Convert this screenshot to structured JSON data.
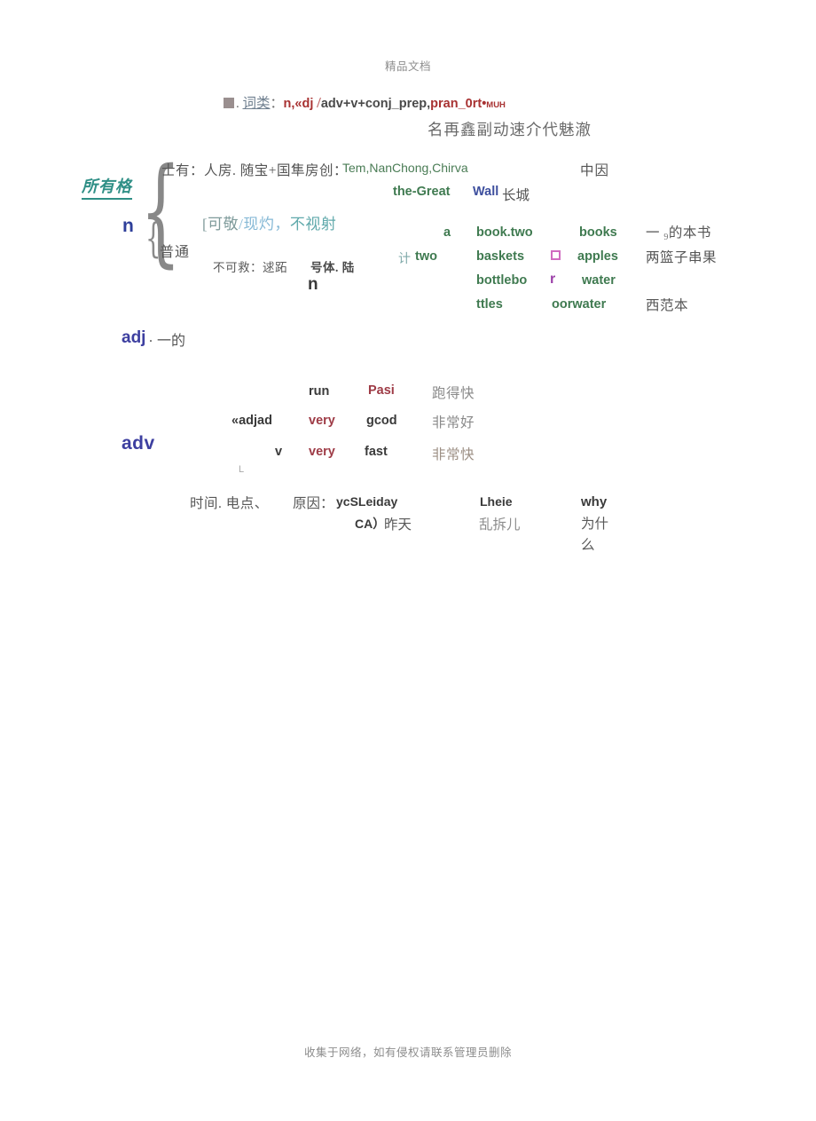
{
  "document": {
    "watermark_top": "精品文档",
    "watermark_bottom": "收集于网络，如有侵权请联系管理员删除"
  },
  "header": {
    "bullet_icon": "filled-square-bullet",
    "label_cn": "词类",
    "colon": "：",
    "pos_red": "n,«dj",
    "slash": "/",
    "pos_dark": "adv+v+conj_prep,",
    "pos_red2": "pran_0rt•",
    "pos_tiny": "MUH",
    "gloss_cn": "名再鑫副动速介代魅澈"
  },
  "noun_section": {
    "label_top": "所有格",
    "label_bottom": "n",
    "brace_outer": "{",
    "brace_inner": "{",
    "proper": {
      "cn_head": "士有：人房. 随宝+国隼房创：",
      "examples_en": "Tem,NanChong,Chirva",
      "gloss_cn": "中因",
      "example2_green": "the-Great",
      "example2_blue": "Wall",
      "example2_cn": "长城"
    },
    "bracket_note": {
      "part1": "[可敬",
      "part2": "/现灼，",
      "part3": "不视射"
    },
    "common": {
      "label": "普通",
      "uncountable_cn": "不可救：逑跖",
      "countable_cn": "号体. 陆",
      "countable_n": "n"
    },
    "examples_table": {
      "count_label_cn": "计",
      "col1": [
        "a",
        "two",
        "",
        ""
      ],
      "col2": [
        "book.two",
        "baskets",
        "bottlebo",
        "ttles"
      ],
      "symbols": [
        "",
        "square-outline",
        "r",
        ""
      ],
      "col3": [
        "books",
        "apples",
        "water",
        "oorwater"
      ],
      "glosses": [
        "一 9 的本书",
        "两篮子串果",
        "",
        "西范本"
      ]
    }
  },
  "adj_section": {
    "label": "adj",
    "dot": ".",
    "gloss_cn": "一的"
  },
  "adv_section": {
    "label": "adv",
    "marker_L": "L",
    "rows": [
      {
        "modifies": "",
        "adverb": "run",
        "word": "Pasi",
        "gloss": "跑得快"
      },
      {
        "modifies": "«adjad",
        "adverb": "very",
        "word": "gcod",
        "gloss": "非常好"
      },
      {
        "modifies": "v",
        "adverb": "very",
        "word": "fast",
        "gloss": "非常快"
      }
    ]
  },
  "bottom_row": {
    "time_place_cn": "时间. 电点、",
    "reason_cn": "原因：",
    "reason_en": "ycSLeiday",
    "reason_en2": "CA）",
    "reason_gloss": "昨天",
    "where_en": "Lheie",
    "where_gloss": "乱拆儿",
    "why_en": "why",
    "why_gloss": "为什么"
  }
}
